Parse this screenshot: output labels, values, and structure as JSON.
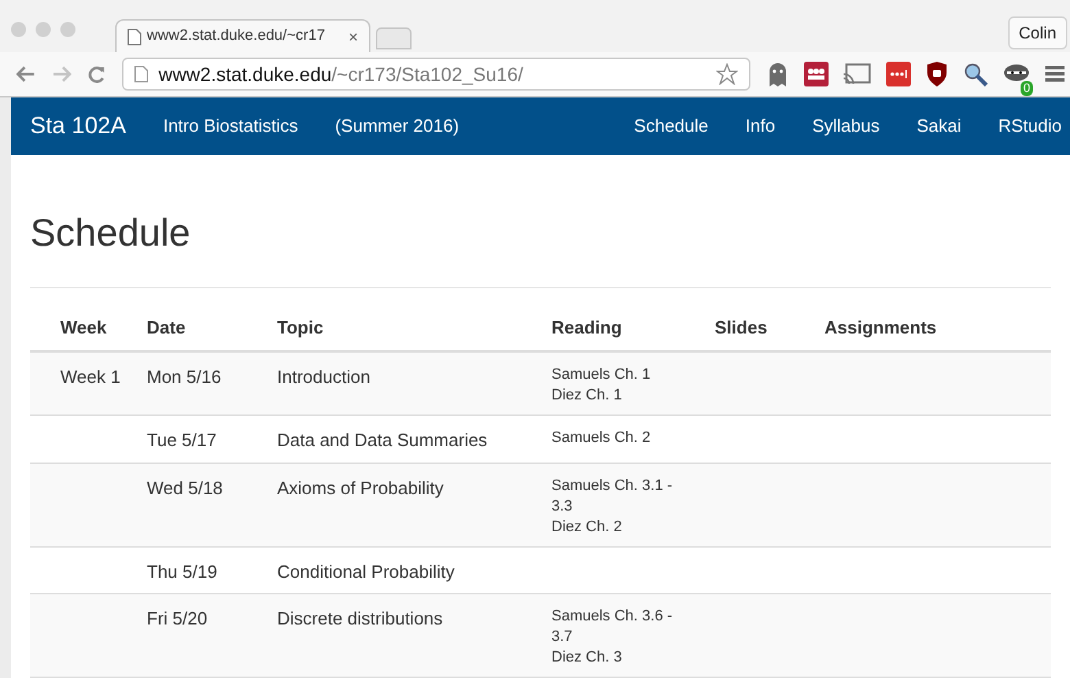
{
  "browser": {
    "tab_title": "www2.stat.duke.edu/~cr17",
    "tab_close": "×",
    "profile": "Colin",
    "url_host": "www2.stat.duke.edu",
    "url_path": "/~cr173/Sta102_Su16/",
    "extension_badge": "0"
  },
  "navbar": {
    "brand": "Sta 102A",
    "subtitle": "Intro Biostatistics",
    "term": "(Summer 2016)",
    "links": [
      "Schedule",
      "Info",
      "Syllabus",
      "Sakai",
      "RStudio"
    ]
  },
  "heading": "Schedule",
  "table": {
    "columns": [
      "Week",
      "Date",
      "Topic",
      "Reading",
      "Slides",
      "Assignments"
    ],
    "rows": [
      {
        "week": "Week 1",
        "date": "Mon 5/16",
        "topic": "Introduction",
        "reading": [
          "Samuels Ch. 1",
          "Diez Ch. 1"
        ]
      },
      {
        "week": "",
        "date": "Tue 5/17",
        "topic": "Data and Data Summaries",
        "reading": [
          "Samuels Ch. 2"
        ]
      },
      {
        "week": "",
        "date": "Wed 5/18",
        "topic": "Axioms of Probability",
        "reading": [
          "Samuels Ch. 3.1 - 3.3",
          "Diez Ch. 2"
        ]
      },
      {
        "week": "",
        "date": "Thu 5/19",
        "topic": "Conditional Probability",
        "reading": []
      },
      {
        "week": "",
        "date": "Fri 5/20",
        "topic": "Discrete distributions",
        "reading": [
          "Samuels Ch. 3.6 - 3.7",
          "Diez Ch. 3"
        ]
      }
    ]
  }
}
